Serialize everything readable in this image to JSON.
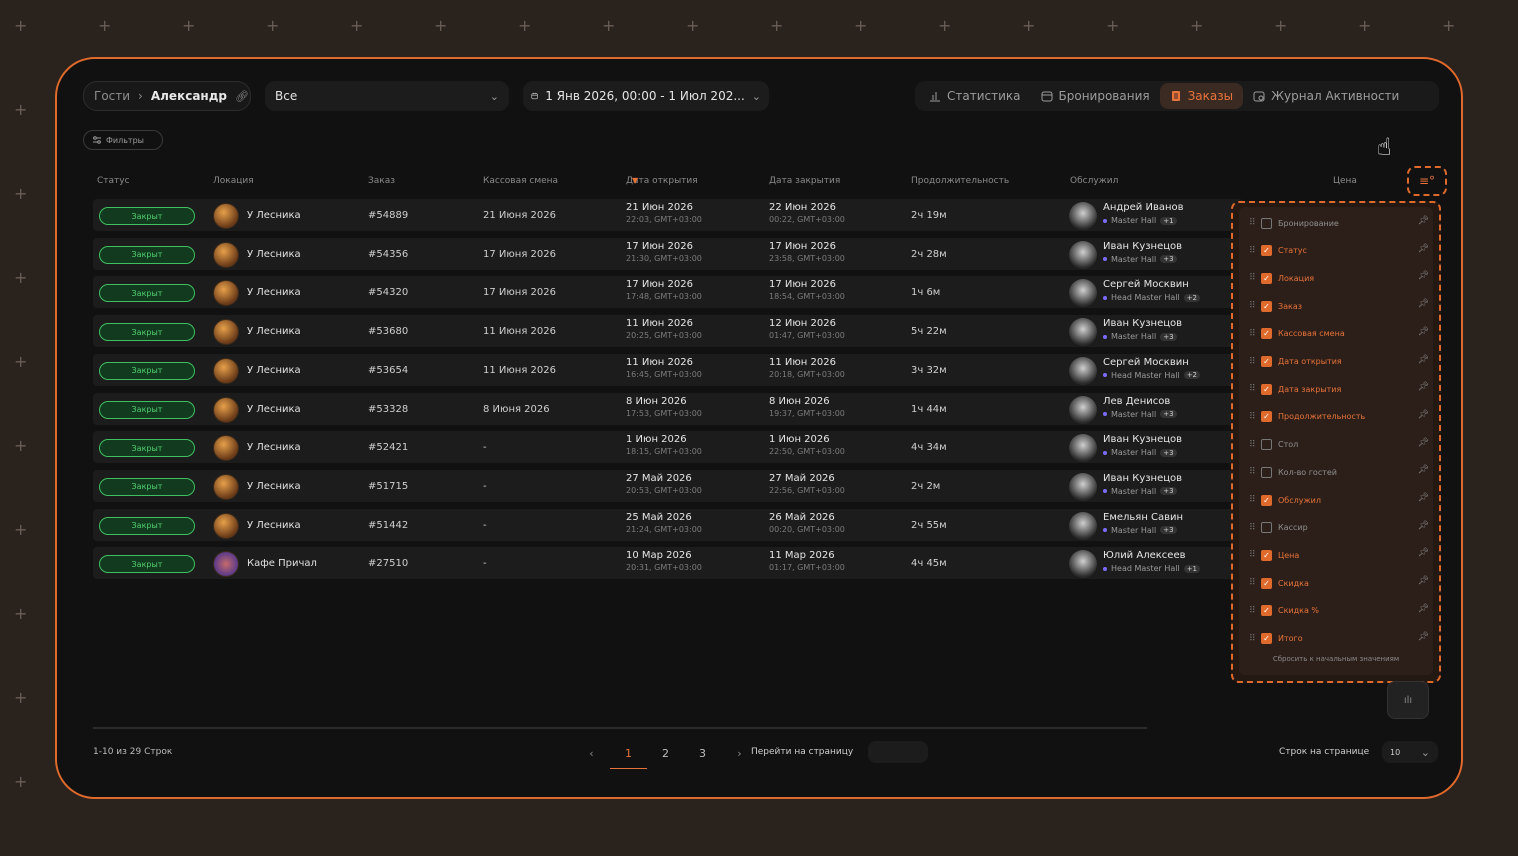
{
  "breadcrumb": {
    "root": "Гости",
    "current": "Александр"
  },
  "selector": {
    "value": "Все"
  },
  "date_range": {
    "value": "1 Янв 2026, 00:00 - 1 Июл 202..."
  },
  "tabs": [
    {
      "label": "Статистика",
      "icon": "chart-icon",
      "active": false
    },
    {
      "label": "Бронирования",
      "icon": "calendar-icon",
      "active": false
    },
    {
      "label": "Заказы",
      "icon": "document-icon",
      "active": true
    },
    {
      "label": "Журнал Активности",
      "icon": "calendar-clock-icon",
      "active": false
    }
  ],
  "filters_label": "Фильтры",
  "columns": {
    "status": "Статус",
    "location": "Локация",
    "order": "Заказ",
    "shift": "Кассовая смена",
    "opened": "Дата открытия",
    "closed": "Дата закрытия",
    "duration": "Продолжительность",
    "staff": "Обслужил",
    "price": "Цена"
  },
  "rows": [
    {
      "status": "Закрыт",
      "location": "У Лесника",
      "order": "#54889",
      "shift": "21 Июня 2026",
      "open_date": "21 Июн 2026",
      "open_time": "22:03, GMT+03:00",
      "close_date": "22 Июн 2026",
      "close_time": "00:22, GMT+03:00",
      "duration": "2ч 19м",
      "staff": "Андрей Иванов",
      "role": "Master Hall",
      "extra": "+1"
    },
    {
      "status": "Закрыт",
      "location": "У Лесника",
      "order": "#54356",
      "shift": "17 Июня 2026",
      "open_date": "17 Июн 2026",
      "open_time": "21:30, GMT+03:00",
      "close_date": "17 Июн 2026",
      "close_time": "23:58, GMT+03:00",
      "duration": "2ч 28м",
      "staff": "Иван Кузнецов",
      "role": "Master Hall",
      "extra": "+3"
    },
    {
      "status": "Закрыт",
      "location": "У Лесника",
      "order": "#54320",
      "shift": "17 Июня 2026",
      "open_date": "17 Июн 2026",
      "open_time": "17:48, GMT+03:00",
      "close_date": "17 Июн 2026",
      "close_time": "18:54, GMT+03:00",
      "duration": "1ч 6м",
      "staff": "Сергей Москвин",
      "role": "Head Master Hall",
      "extra": "+2"
    },
    {
      "status": "Закрыт",
      "location": "У Лесника",
      "order": "#53680",
      "shift": "11 Июня 2026",
      "open_date": "11 Июн 2026",
      "open_time": "20:25, GMT+03:00",
      "close_date": "12 Июн 2026",
      "close_time": "01:47, GMT+03:00",
      "duration": "5ч 22м",
      "staff": "Иван Кузнецов",
      "role": "Master Hall",
      "extra": "+3"
    },
    {
      "status": "Закрыт",
      "location": "У Лесника",
      "order": "#53654",
      "shift": "11 Июня 2026",
      "open_date": "11 Июн 2026",
      "open_time": "16:45, GMT+03:00",
      "close_date": "11 Июн 2026",
      "close_time": "20:18, GMT+03:00",
      "duration": "3ч 32м",
      "staff": "Сергей Москвин",
      "role": "Head Master Hall",
      "extra": "+2"
    },
    {
      "status": "Закрыт",
      "location": "У Лесника",
      "order": "#53328",
      "shift": "8 Июня 2026",
      "open_date": "8 Июн 2026",
      "open_time": "17:53, GMT+03:00",
      "close_date": "8 Июн 2026",
      "close_time": "19:37, GMT+03:00",
      "duration": "1ч 44м",
      "staff": "Лев Денисов",
      "role": "Master Hall",
      "extra": "+3"
    },
    {
      "status": "Закрыт",
      "location": "У Лесника",
      "order": "#52421",
      "shift": "-",
      "open_date": "1 Июн 2026",
      "open_time": "18:15, GMT+03:00",
      "close_date": "1 Июн 2026",
      "close_time": "22:50, GMT+03:00",
      "duration": "4ч 34м",
      "staff": "Иван Кузнецов",
      "role": "Master Hall",
      "extra": "+3"
    },
    {
      "status": "Закрыт",
      "location": "У Лесника",
      "order": "#51715",
      "shift": "-",
      "open_date": "27 Май 2026",
      "open_time": "20:53, GMT+03:00",
      "close_date": "27 Май 2026",
      "close_time": "22:56, GMT+03:00",
      "duration": "2ч 2м",
      "staff": "Иван Кузнецов",
      "role": "Master Hall",
      "extra": "+3"
    },
    {
      "status": "Закрыт",
      "location": "У Лесника",
      "order": "#51442",
      "shift": "-",
      "open_date": "25 Май 2026",
      "open_time": "21:24, GMT+03:00",
      "close_date": "26 Май 2026",
      "close_time": "00:20, GMT+03:00",
      "duration": "2ч 55м",
      "staff": "Емельян Савин",
      "role": "Master Hall",
      "extra": "+3"
    },
    {
      "status": "Закрыт",
      "location": "Кафе Причал",
      "order": "#27510",
      "shift": "-",
      "open_date": "10 Мар 2026",
      "open_time": "20:31, GMT+03:00",
      "close_date": "11 Мар 2026",
      "close_time": "01:17, GMT+03:00",
      "duration": "4ч 45м",
      "staff": "Юлий Алексеев",
      "role": "Head Master Hall",
      "extra": "+1"
    }
  ],
  "column_panel": {
    "options": [
      {
        "label": "Бронирование",
        "checked": false
      },
      {
        "label": "Статус",
        "checked": true
      },
      {
        "label": "Локация",
        "checked": true
      },
      {
        "label": "Заказ",
        "checked": true
      },
      {
        "label": "Кассовая смена",
        "checked": true
      },
      {
        "label": "Дата открытия",
        "checked": true
      },
      {
        "label": "Дата закрытия",
        "checked": true
      },
      {
        "label": "Продолжительность",
        "checked": true
      },
      {
        "label": "Стол",
        "checked": false
      },
      {
        "label": "Кол-во гостей",
        "checked": false
      },
      {
        "label": "Обслужил",
        "checked": true
      },
      {
        "label": "Кассир",
        "checked": false
      },
      {
        "label": "Цена",
        "checked": true
      },
      {
        "label": "Скидка",
        "checked": true
      },
      {
        "label": "Скидка %",
        "checked": true
      },
      {
        "label": "Итого",
        "checked": true
      }
    ],
    "reset": "Сбросить к начальным значениям"
  },
  "pagination": {
    "info": "1-10 из 29 Строк",
    "pages": [
      "1",
      "2",
      "3"
    ],
    "active_page": "1",
    "goto_label": "Перейти на страницу",
    "rows_per_page_label": "Строк на странице",
    "rows_per_page": "10"
  },
  "colors": {
    "accent": "#e06a2c",
    "status_green": "#3fbf60"
  }
}
